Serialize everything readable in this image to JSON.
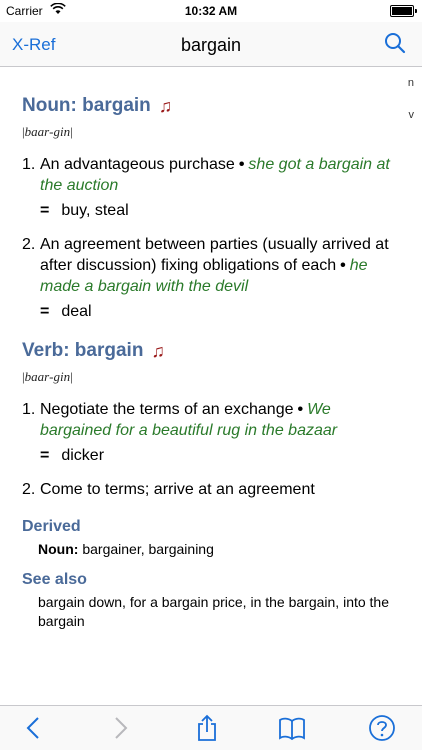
{
  "status": {
    "carrier": "Carrier",
    "time": "10:32 AM"
  },
  "nav": {
    "back_label": "X-Ref",
    "title": "bargain"
  },
  "index": [
    "n",
    "v"
  ],
  "noun": {
    "heading": "Noun: bargain",
    "pron": [
      "baar",
      "gin"
    ],
    "senses": [
      {
        "num": "1.",
        "def": "An advantageous purchase",
        "example": "she got a bargain at the auction",
        "syn": "buy, steal"
      },
      {
        "num": "2.",
        "def": "An agreement between parties (usually arrived at after discussion) fixing obligations of each",
        "example": "he made a bargain with the devil",
        "syn": "deal"
      }
    ]
  },
  "verb": {
    "heading": "Verb: bargain",
    "pron": [
      "baar",
      "gin"
    ],
    "senses": [
      {
        "num": "1.",
        "def": "Negotiate the terms of an exchange",
        "example": "We bargained for a beautiful rug in the bazaar",
        "syn": "dicker"
      },
      {
        "num": "2.",
        "def": "Come to terms; arrive at an agreement"
      }
    ]
  },
  "derived": {
    "heading": "Derived",
    "label": "Noun:",
    "text": "bargainer, bargaining"
  },
  "see_also": {
    "heading": "See also",
    "text": "bargain down, for a bargain price, in the bargain, into the bargain"
  },
  "accent_color": "#1a6fd8",
  "heading_color": "#4a6a99",
  "example_color": "#2a7a2a"
}
